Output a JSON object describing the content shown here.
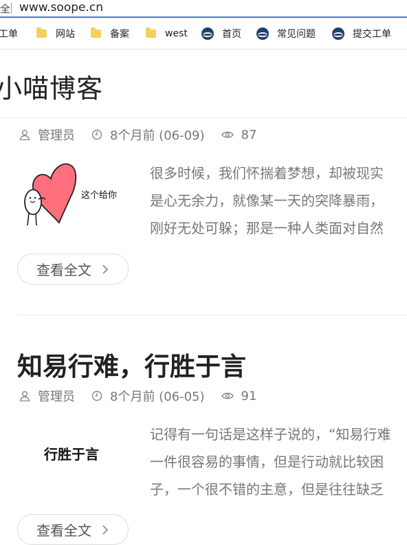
{
  "browser": {
    "address_prefix": "全",
    "url": "www.soope.cn",
    "bookmarks": [
      {
        "label": "工单",
        "icon": "none"
      },
      {
        "label": "网站",
        "icon": "folder-icon"
      },
      {
        "label": "备案",
        "icon": "folder-icon"
      },
      {
        "label": "west",
        "icon": "folder-icon"
      },
      {
        "label": "首页",
        "icon": "globe-icon"
      },
      {
        "label": "常见问题",
        "icon": "globe-icon"
      },
      {
        "label": "提交工单",
        "icon": "globe-icon"
      }
    ]
  },
  "blog": {
    "title": "小喵博客"
  },
  "posts": [
    {
      "author": "管理员",
      "date": "8个月前 (06-09)",
      "views": "87",
      "thumb_text": "这个给你",
      "excerpt": [
        "很多时候，我们怀揣着梦想，却被现实",
        "是心无余力，就像某一天的突降暴雨，",
        "刚好无处可躲；那是一种人类面对自然"
      ],
      "read_more": "查看全文"
    },
    {
      "title": "知易行难，行胜于言",
      "author": "管理员",
      "date": "8个月前 (06-05)",
      "views": "91",
      "thumb_text": "行胜于言",
      "excerpt": [
        "记得有一句话是这样子说的，“知易行难",
        "一件很容易的事情，但是行动就比较困",
        "子，一个很不错的主意，但是往往缺乏"
      ],
      "read_more": "查看全文"
    }
  ],
  "colors": {
    "accent": "#3b7ddd",
    "meta_text": "#777777",
    "heart": "#ff6f7d"
  }
}
